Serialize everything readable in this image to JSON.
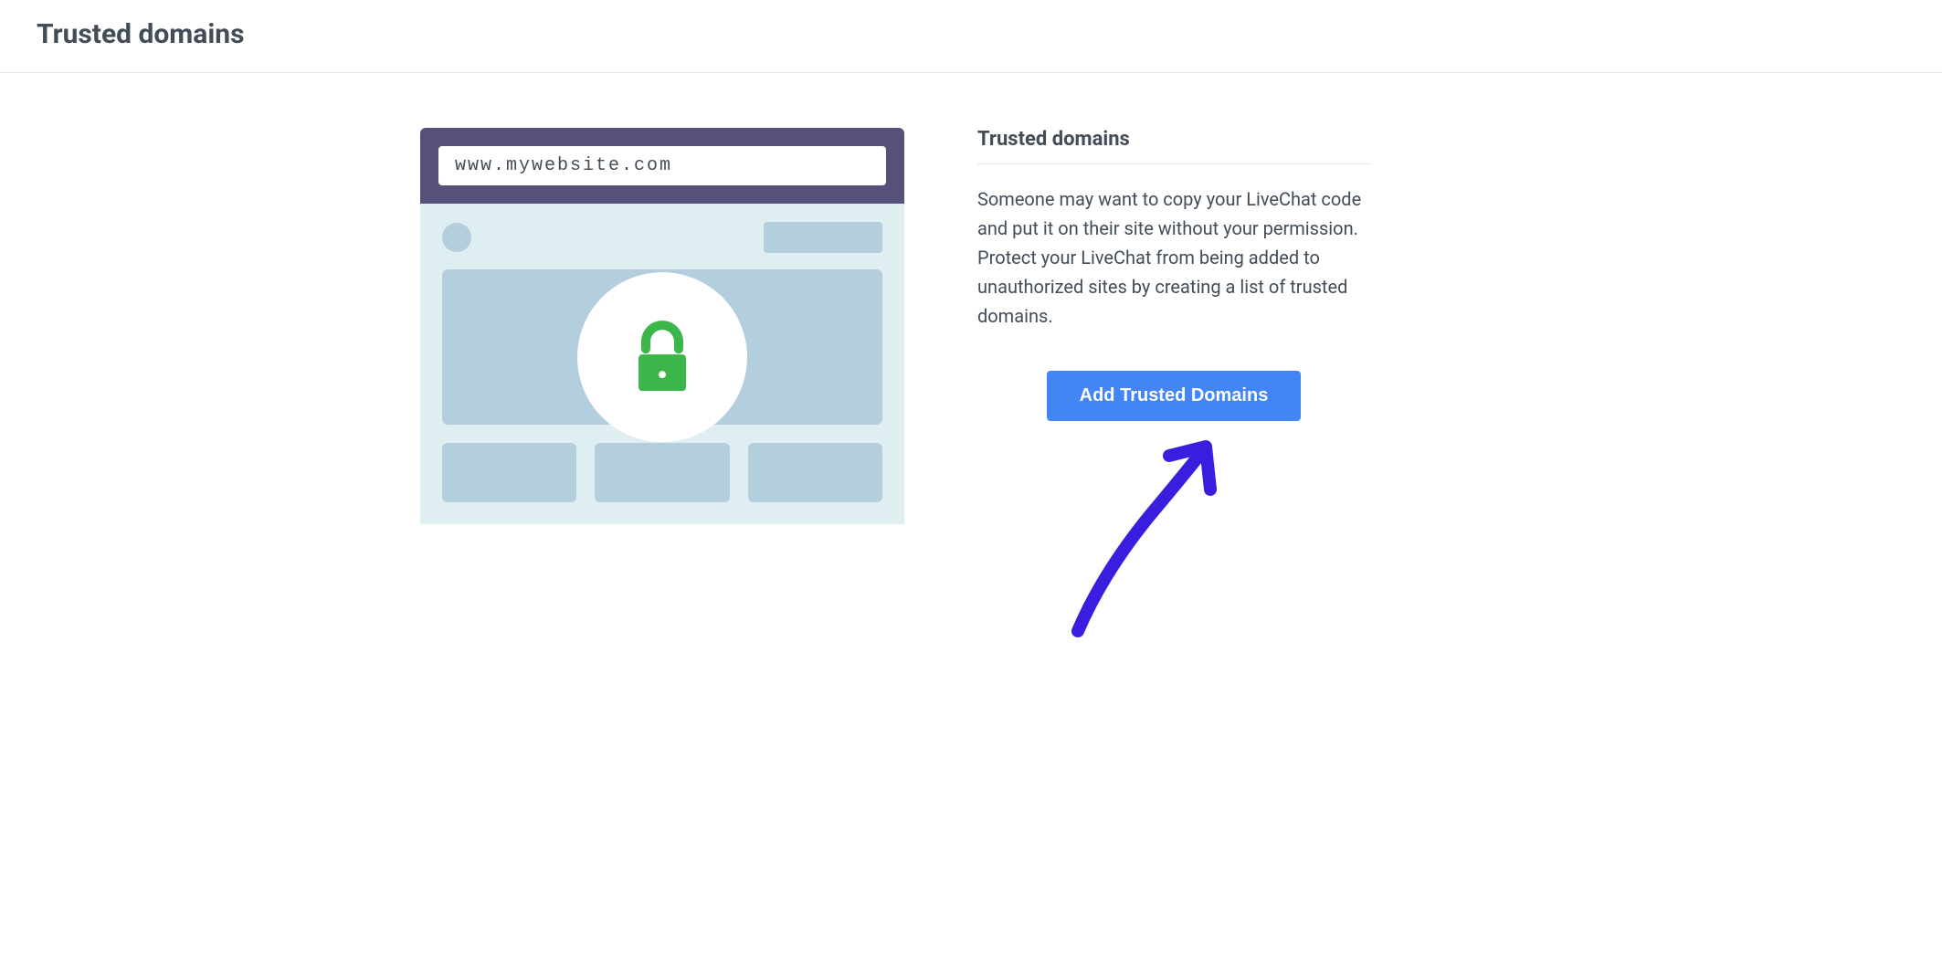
{
  "header": {
    "title": "Trusted domains"
  },
  "illustration": {
    "url_text": "www.mywebsite.com"
  },
  "panel": {
    "title": "Trusted domains",
    "description": "Someone may want to copy your LiveChat code and put it on their site without your permission. Protect your LiveChat from being added to unauthorized sites by creating a list of trusted domains.",
    "cta_label": "Add Trusted Domains"
  },
  "colors": {
    "accent": "#4285f4",
    "lock": "#3cb64b"
  }
}
